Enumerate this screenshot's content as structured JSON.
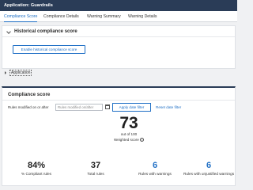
{
  "header": {
    "title": "Application: Guardrails"
  },
  "tabs": [
    {
      "label": "Compliance Score",
      "active": true
    },
    {
      "label": "Compliance Details",
      "active": false
    },
    {
      "label": "Warning Summary",
      "active": false
    },
    {
      "label": "Warning Details",
      "active": false
    }
  ],
  "historical": {
    "title": "Historical compliance score",
    "button": "Enable historical compliance score"
  },
  "application_row": {
    "label": "Application"
  },
  "compliance": {
    "title": "Compliance score",
    "filter_label": "Rules modified on or after",
    "filter_placeholder": "Rules modified on/after",
    "apply_button": "Apply date filter",
    "reset_link": "Reset date filter",
    "score": "73",
    "out_of": "out of 100",
    "weighted_label": "Weighted score",
    "stats": [
      {
        "value": "84%",
        "label": "% Compliant rules",
        "color": "#222222"
      },
      {
        "value": "37",
        "label": "Total rules",
        "color": "#222222"
      },
      {
        "value": "6",
        "label": "Rules with warnings",
        "color": "#1f6fc5"
      },
      {
        "value": "6",
        "label": "Rules with unjustified warnings",
        "color": "#1f6fc5"
      }
    ]
  },
  "colors": {
    "accent": "#1f6fc5",
    "header_bg": "#2a3c57"
  },
  "icons": [
    "chevron-down-icon",
    "caret-right-icon",
    "calendar-icon",
    "info-icon"
  ]
}
